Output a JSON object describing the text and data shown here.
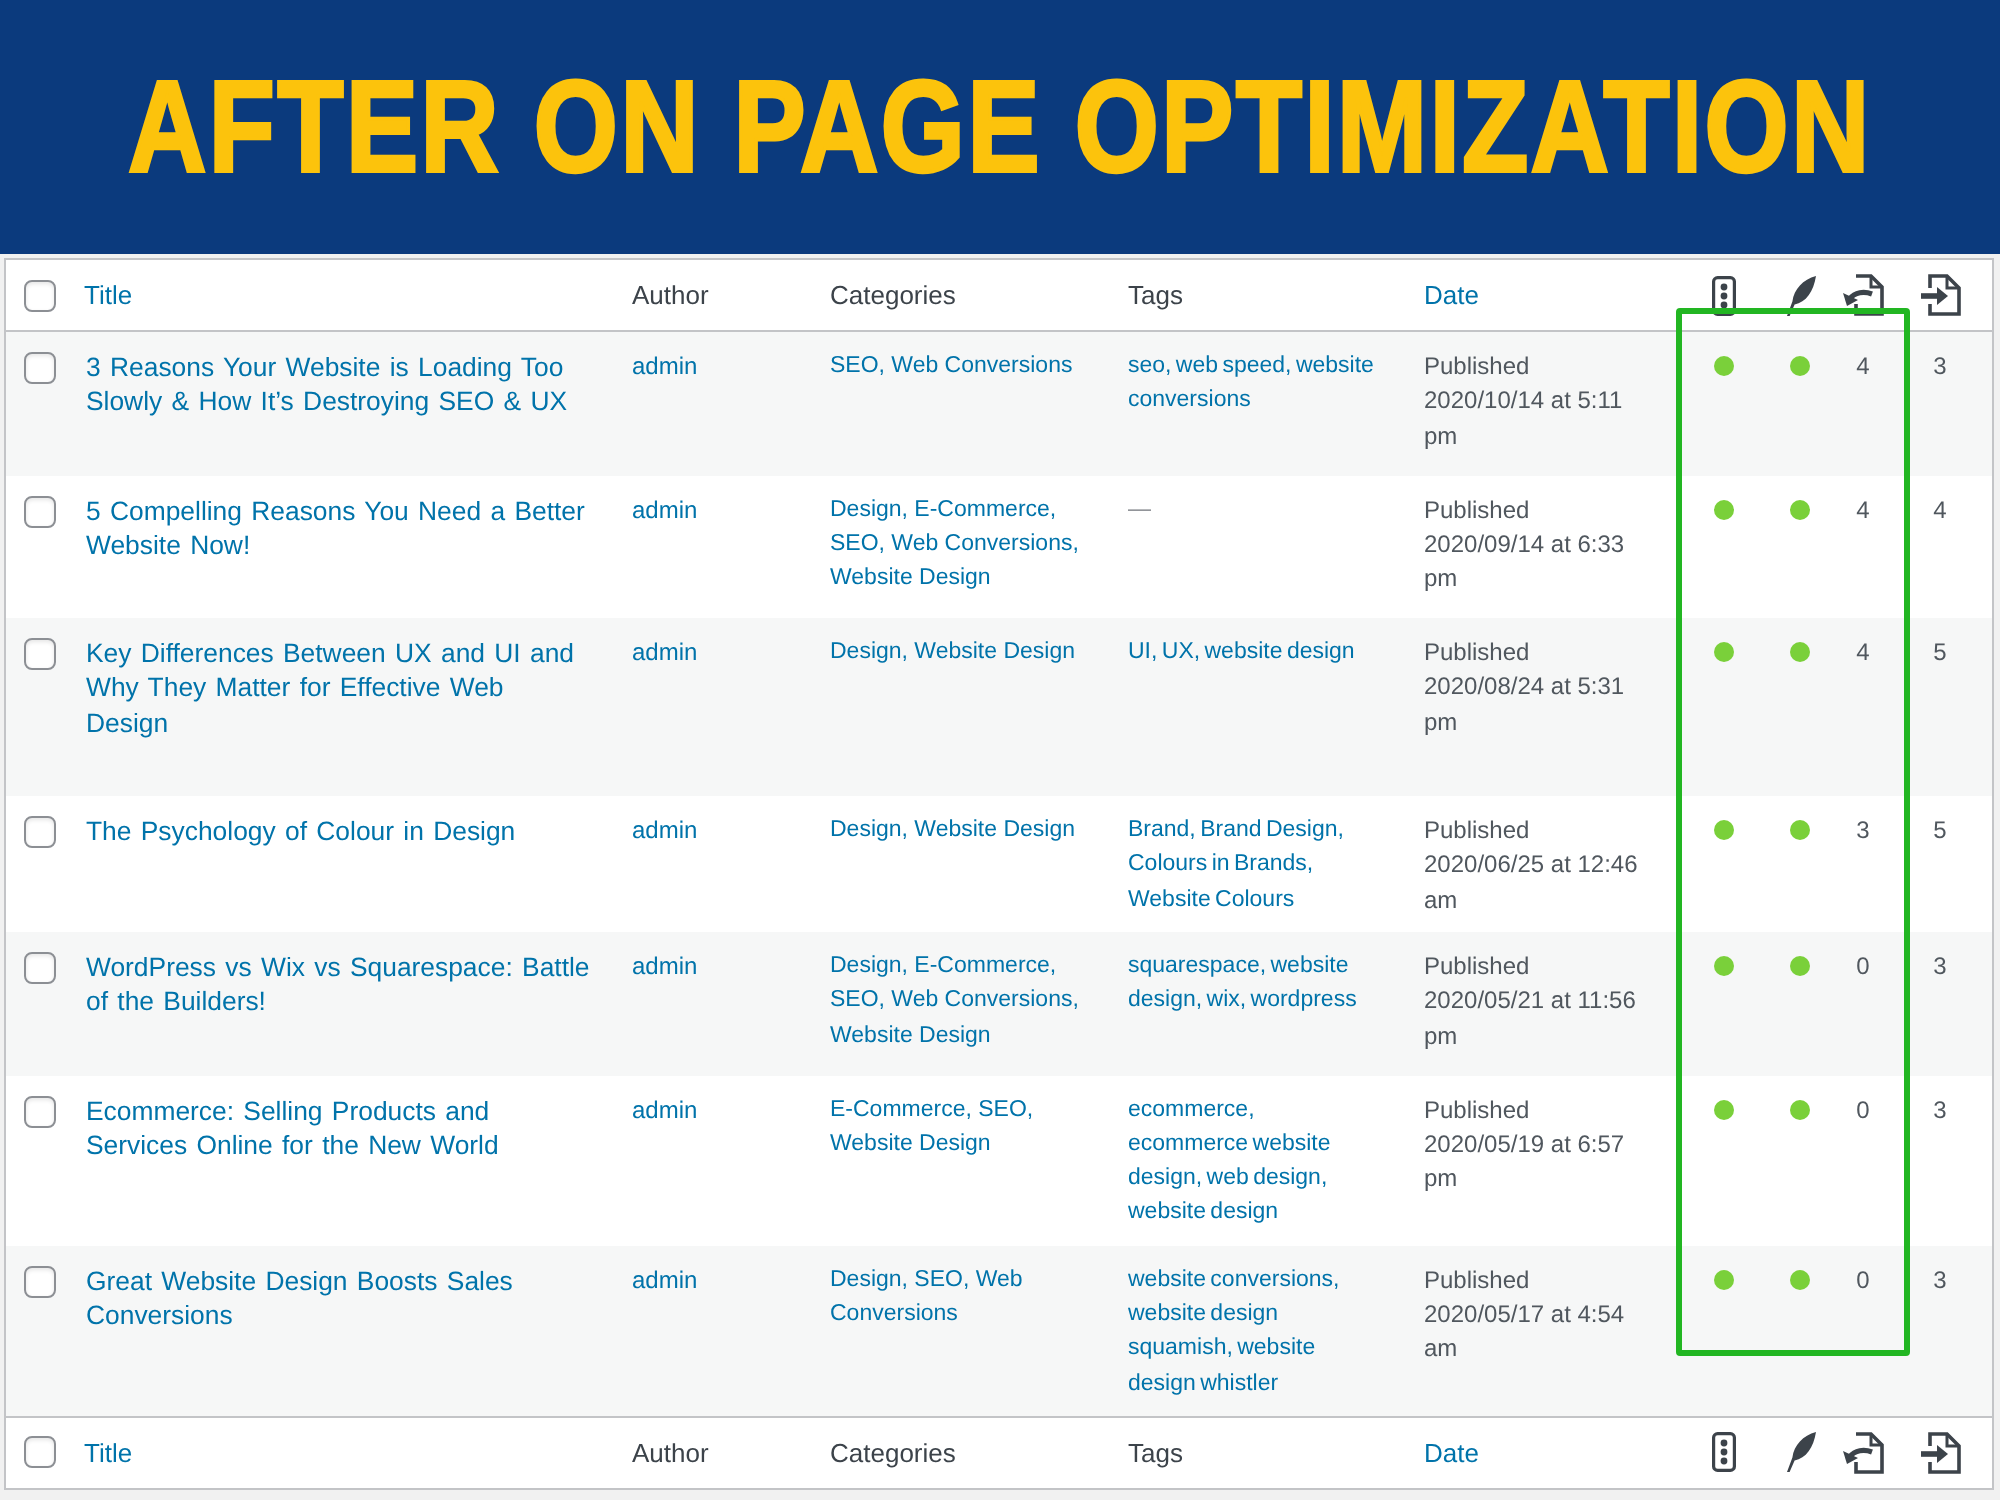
{
  "banner": {
    "title": "AFTER ON PAGE OPTIMIZATION"
  },
  "table": {
    "header": {
      "checked": false,
      "columns": [
        {
          "label": "Title",
          "sortable": true
        },
        {
          "label": "Author",
          "sortable": false
        },
        {
          "label": "Categories",
          "sortable": false
        },
        {
          "label": "Tags",
          "sortable": false
        },
        {
          "label": "Date",
          "sortable": true
        }
      ]
    },
    "rows": [
      {
        "checked": false,
        "title": "3 Reasons Your Website is Loading Too Slowly & How It’s Destroying SEO & UX",
        "author": "admin",
        "categories": "SEO, Web Conversions",
        "tags": {
          "text": "seo, web speed, website conversions",
          "kind": "links"
        },
        "status": "Published",
        "date": "2020/10/14 at 5:11 pm",
        "column_6": {
          "color": "#7ad03a"
        },
        "column_7": {
          "color": "#7ad03a"
        },
        "column_8": "4",
        "column_9": "3"
      },
      {
        "checked": false,
        "title": "5 Compelling Reasons You Need a Better Website Now!",
        "author": "admin",
        "categories": "Design, E-Commerce, SEO, Web Conversions, Website Design",
        "tags": {
          "text": "—",
          "kind": "none"
        },
        "status": "Published",
        "date": "2020/09/14 at 6:33 pm",
        "column_6": {
          "color": "#7ad03a"
        },
        "column_7": {
          "color": "#7ad03a"
        },
        "column_8": "4",
        "column_9": "4"
      },
      {
        "checked": false,
        "title": "Key Differences Between UX and UI and Why They Matter for Effective Web Design",
        "author": "admin",
        "categories": "Design, Website Design",
        "tags": {
          "text": "UI, UX, website design",
          "kind": "links"
        },
        "status": "Published",
        "date": "2020/08/24 at 5:31 pm",
        "column_6": {
          "color": "#7ad03a"
        },
        "column_7": {
          "color": "#7ad03a"
        },
        "column_8": "4",
        "column_9": "5"
      },
      {
        "checked": false,
        "title": "The Psychology of Colour in Design",
        "author": "admin",
        "categories": "Design, Website Design",
        "tags": {
          "text": "Brand, Brand Design, Colours in Brands, Website Colours",
          "kind": "links"
        },
        "status": "Published",
        "date": "2020/06/25 at 12:46 am",
        "column_6": {
          "color": "#7ad03a"
        },
        "column_7": {
          "color": "#7ad03a"
        },
        "column_8": "3",
        "column_9": "5"
      },
      {
        "checked": false,
        "title": "WordPress vs Wix vs Squarespace: Battle of the Builders!",
        "author": "admin",
        "categories": "Design, E-Commerce, SEO, Web Conversions, Website Design",
        "tags": {
          "text": "squarespace, website design, wix, wordpress",
          "kind": "links"
        },
        "status": "Published",
        "date": "2020/05/21 at 11:56 pm",
        "column_6": {
          "color": "#7ad03a"
        },
        "column_7": {
          "color": "#7ad03a"
        },
        "column_8": "0",
        "column_9": "3"
      },
      {
        "checked": false,
        "title": "Ecommerce: Selling Products and Services Online for the New World",
        "author": "admin",
        "categories": "E-Commerce, SEO, Website Design",
        "tags": {
          "text": "ecommerce, ecommerce website design, web design, website design",
          "kind": "links"
        },
        "status": "Published",
        "date": "2020/05/19 at 6:57 pm",
        "column_6": {
          "color": "#7ad03a"
        },
        "column_7": {
          "color": "#7ad03a"
        },
        "column_8": "0",
        "column_9": "3"
      },
      {
        "checked": false,
        "title": "Great Website Design Boosts Sales Conversions",
        "author": "admin",
        "categories": "Design, SEO, Web Conversions",
        "tags": {
          "text": "website conversions, website design squamish, website design whistler",
          "kind": "links"
        },
        "status": "Published",
        "date": "2020/05/17 at 4:54 am",
        "column_6": {
          "color": "#7ad03a"
        },
        "column_7": {
          "color": "#7ad03a"
        },
        "column_8": "0",
        "column_9": "3"
      }
    ],
    "footer": {
      "checked": false,
      "columns": [
        {
          "label": "Title",
          "sortable": true
        },
        {
          "label": "Author",
          "sortable": false
        },
        {
          "label": "Categories",
          "sortable": false
        },
        {
          "label": "Tags",
          "sortable": false
        },
        {
          "label": "Date",
          "sortable": true
        }
      ]
    }
  }
}
